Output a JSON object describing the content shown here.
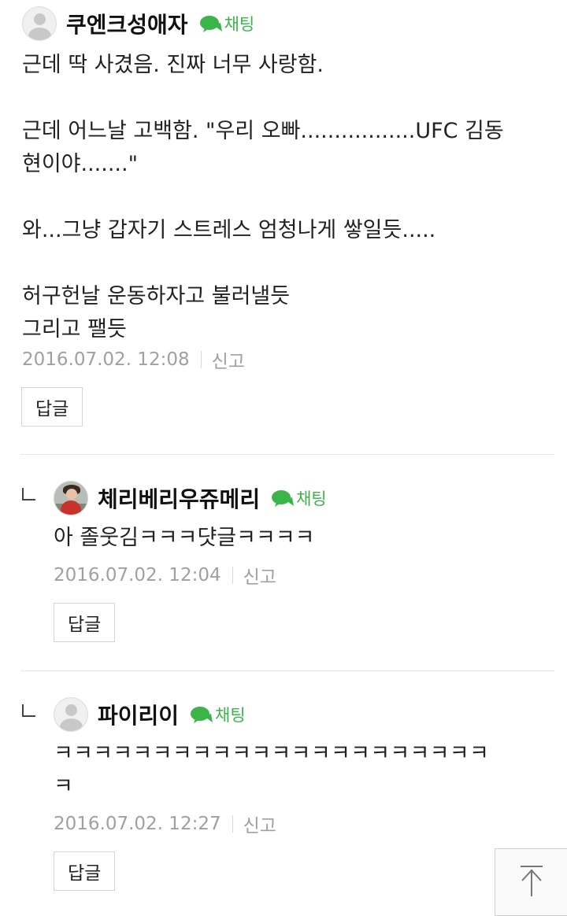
{
  "comments": [
    {
      "nickname": "쿠엔크성애자",
      "chat_label": "채팅",
      "body": "근데 딱 사겼음. 진짜 너무 사랑함.\n\n근데 어느날 고백함. \"우리 오빠.................UFC 김동\n현이야.......\"\n\n와...그냥 갑자기 스트레스 엄청나게 쌓일듯.....\n\n허구헌날 운동하자고 불러낼듯\n그리고 팰듯",
      "date": "2016.07.02. 12:08",
      "report_label": "신고",
      "reply_label": "답글"
    },
    {
      "nickname": "체리베리우쥬메리",
      "chat_label": "채팅",
      "body": "아 졸웃김ㅋㅋㅋ댯글ㅋㅋㅋㅋ",
      "date": "2016.07.02. 12:04",
      "report_label": "신고",
      "reply_label": "답글"
    },
    {
      "nickname": "파이리이",
      "chat_label": "채팅",
      "body": "ㅋㅋㅋㅋㅋㅋㅋㅋㅋㅋㅋㅋㅋㅋㅋㅋㅋㅋㅋㅋㅋㅋ\nㅋ",
      "date": "2016.07.02. 12:27",
      "report_label": "신고",
      "reply_label": "답글"
    }
  ],
  "colors": {
    "chat_green": "#3bb54a",
    "meta_gray": "#a0a0a0"
  },
  "icons": {
    "chat": "speech-bubble-icon",
    "reply_marker": "reply-arrow-icon",
    "scroll_top": "arrow-up-icon"
  }
}
